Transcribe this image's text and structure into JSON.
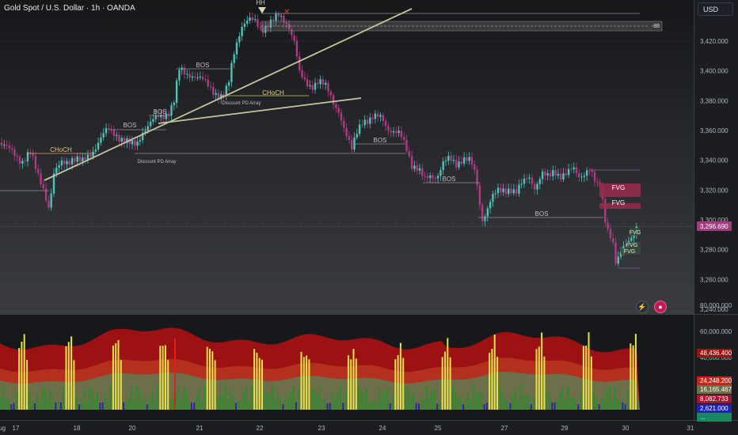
{
  "header": {
    "title": "Gold Spot / U.S. Dollar · 1h · OANDA",
    "currency_button": "USD"
  },
  "colors": {
    "bull": "#4fc3b8",
    "bear": "#b13a85",
    "structure_line": "#c9c29e",
    "volume_green": "#2f8a2f",
    "volume_yellow": "#e8e24a",
    "volume_blue": "#27289a",
    "band_red": "#9c1212",
    "band_olive": "#6d6f4a",
    "fvg_fill": "#9b2a4e",
    "price_tag": "#a23d7d"
  },
  "chart_data": {
    "type": "candlestick",
    "symbol": "Gold Spot / U.S. Dollar",
    "interval": "1h",
    "broker": "OANDA",
    "ylim": [
      3235,
      3445
    ],
    "y_ticks": [
      "3,420.000",
      "3,400.000",
      "3,380.000",
      "3,360.000",
      "3,340.000",
      "3,320.000",
      "3,300.000",
      "3,280.000",
      "3,260.000",
      "3,240.000"
    ],
    "x_ticks": [
      "17",
      "18",
      "20",
      "21",
      "22",
      "23",
      "24",
      "25",
      "27",
      "29",
      "30",
      "31",
      "Aug"
    ],
    "last_price": "3,296.690",
    "close_path": [
      [
        0,
        3352
      ],
      [
        8,
        3348
      ],
      [
        18,
        3344
      ],
      [
        28,
        3340
      ],
      [
        38,
        3345
      ],
      [
        46,
        3332
      ],
      [
        55,
        3322
      ],
      [
        62,
        3308
      ],
      [
        68,
        3330
      ],
      [
        78,
        3338
      ],
      [
        92,
        3342
      ],
      [
        104,
        3338
      ],
      [
        116,
        3346
      ],
      [
        126,
        3354
      ],
      [
        136,
        3360
      ],
      [
        146,
        3358
      ],
      [
        156,
        3354
      ],
      [
        164,
        3350
      ],
      [
        172,
        3350
      ],
      [
        180,
        3360
      ],
      [
        188,
        3364
      ],
      [
        198,
        3368
      ],
      [
        206,
        3370
      ],
      [
        214,
        3374
      ],
      [
        220,
        3380
      ],
      [
        226,
        3400
      ],
      [
        234,
        3398
      ],
      [
        244,
        3398
      ],
      [
        254,
        3394
      ],
      [
        262,
        3390
      ],
      [
        272,
        3386
      ],
      [
        280,
        3383
      ],
      [
        288,
        3388
      ],
      [
        294,
        3408
      ],
      [
        300,
        3422
      ],
      [
        306,
        3432
      ],
      [
        314,
        3434
      ],
      [
        322,
        3432
      ],
      [
        330,
        3428
      ],
      [
        338,
        3432
      ],
      [
        346,
        3434
      ],
      [
        352,
        3436
      ],
      [
        358,
        3434
      ],
      [
        364,
        3432
      ],
      [
        372,
        3420
      ],
      [
        378,
        3398
      ],
      [
        384,
        3392
      ],
      [
        392,
        3390
      ],
      [
        402,
        3394
      ],
      [
        412,
        3388
      ],
      [
        420,
        3380
      ],
      [
        428,
        3374
      ],
      [
        436,
        3358
      ],
      [
        444,
        3346
      ],
      [
        452,
        3362
      ],
      [
        458,
        3368
      ],
      [
        466,
        3366
      ],
      [
        474,
        3368
      ],
      [
        482,
        3370
      ],
      [
        490,
        3362
      ],
      [
        498,
        3358
      ],
      [
        506,
        3356
      ],
      [
        514,
        3348
      ],
      [
        520,
        3338
      ],
      [
        528,
        3334
      ],
      [
        536,
        3326
      ],
      [
        544,
        3330
      ],
      [
        552,
        3330
      ],
      [
        560,
        3338
      ],
      [
        568,
        3340
      ],
      [
        576,
        3338
      ],
      [
        584,
        3342
      ],
      [
        592,
        3340
      ],
      [
        598,
        3334
      ],
      [
        604,
        3320
      ],
      [
        608,
        3300
      ],
      [
        612,
        3304
      ],
      [
        620,
        3314
      ],
      [
        628,
        3318
      ],
      [
        636,
        3320
      ],
      [
        644,
        3322
      ],
      [
        652,
        3318
      ],
      [
        660,
        3324
      ],
      [
        668,
        3330
      ],
      [
        676,
        3322
      ],
      [
        684,
        3330
      ],
      [
        692,
        3328
      ],
      [
        700,
        3334
      ],
      [
        708,
        3330
      ],
      [
        716,
        3330
      ],
      [
        724,
        3334
      ],
      [
        732,
        3330
      ],
      [
        738,
        3332
      ],
      [
        744,
        3334
      ],
      [
        750,
        3326
      ],
      [
        754,
        3322
      ],
      [
        758,
        3324
      ],
      [
        762,
        3310
      ],
      [
        766,
        3296
      ],
      [
        770,
        3292
      ],
      [
        774,
        3284
      ],
      [
        778,
        3268
      ],
      [
        782,
        3274
      ],
      [
        786,
        3280
      ],
      [
        790,
        3284
      ],
      [
        794,
        3288
      ],
      [
        798,
        3290
      ],
      [
        802,
        3294
      ],
      [
        806,
        3296
      ]
    ],
    "annotations": [
      {
        "label": "HH"
      },
      {
        "label": "CHoCH"
      },
      {
        "label": "CHoCH"
      },
      {
        "label": "BOS"
      },
      {
        "label": "BOS"
      },
      {
        "label": "BOS"
      },
      {
        "label": "BOS"
      },
      {
        "label": "BOS"
      },
      {
        "label": "BOS"
      },
      {
        "label": "Discount PD Array"
      },
      {
        "label": "Discount PD Array"
      },
      {
        "label": "FVG"
      },
      {
        "label": "FVG"
      },
      {
        "label": "FVG"
      },
      {
        "label": "FVG"
      },
      {
        "label": "FVG"
      },
      {
        "label": "-88"
      }
    ],
    "volume_axis": {
      "ylim": [
        0,
        85000
      ],
      "ticks": [
        "80,000.000",
        "60,000.000",
        "40,000.000"
      ],
      "readouts": [
        {
          "value": "48,436.400",
          "color": "#9c1212"
        },
        {
          "value": "24,248.200",
          "color": "#c0281e"
        },
        {
          "value": "16,165.467",
          "color": "#6d6f4a"
        },
        {
          "value": "8,082.733",
          "color": "#a3142f"
        },
        {
          "value": "2,621.000",
          "color": "#1a23b5"
        },
        {
          "value": "...",
          "color": "#188a5a"
        }
      ]
    }
  }
}
